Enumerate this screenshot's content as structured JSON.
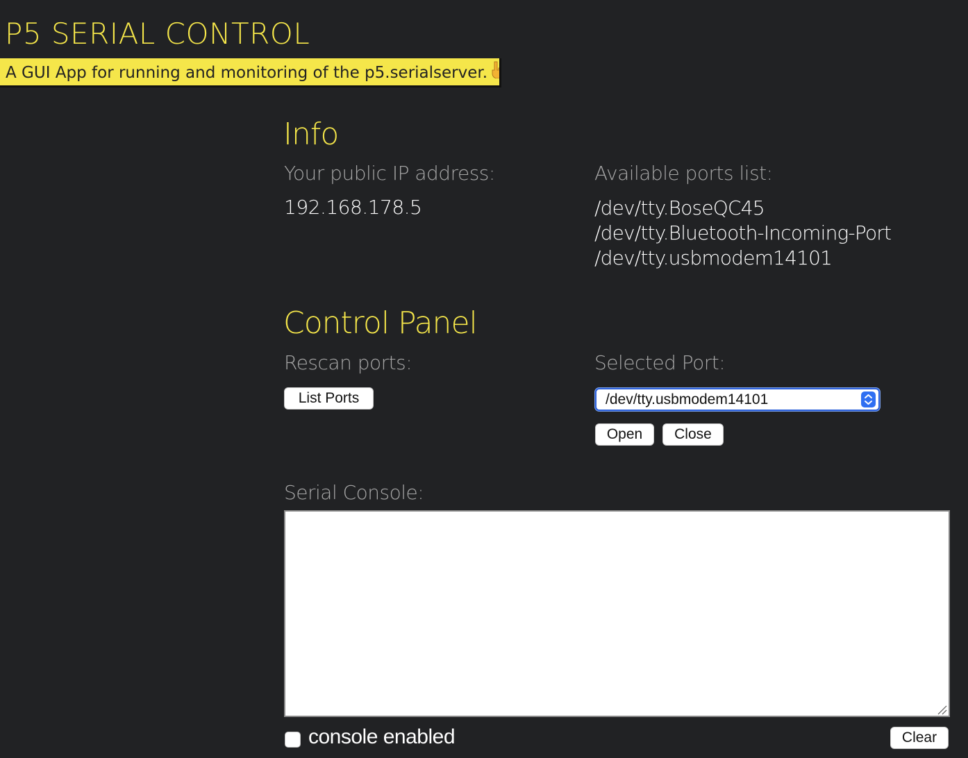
{
  "app": {
    "title": "P5 SERIAL CONTROL",
    "subtitle": "A GUI App for running and monitoring of the p5.serialserver.",
    "subtitle_icon": "pointing-down-hand-icon",
    "accent_color": "#f5e64a",
    "background_color": "#212224"
  },
  "info": {
    "heading": "Info",
    "ip_label": "Your public IP address:",
    "ip_value": "192.168.178.5",
    "ports_label": "Available ports list:",
    "ports": [
      "/dev/tty.BoseQC45",
      "/dev/tty.Bluetooth-Incoming-Port",
      "/dev/tty.usbmodem14101"
    ]
  },
  "control_panel": {
    "heading": "Control Panel",
    "rescan_label": "Rescan ports:",
    "list_ports_button": "List Ports",
    "selected_port_label": "Selected Port:",
    "selected_port_value": "/dev/tty.usbmodem14101",
    "open_button": "Open",
    "close_button": "Close"
  },
  "console": {
    "label": "Serial Console:",
    "content": "",
    "enabled_label": "console enabled",
    "enabled": false,
    "clear_button": "Clear"
  }
}
